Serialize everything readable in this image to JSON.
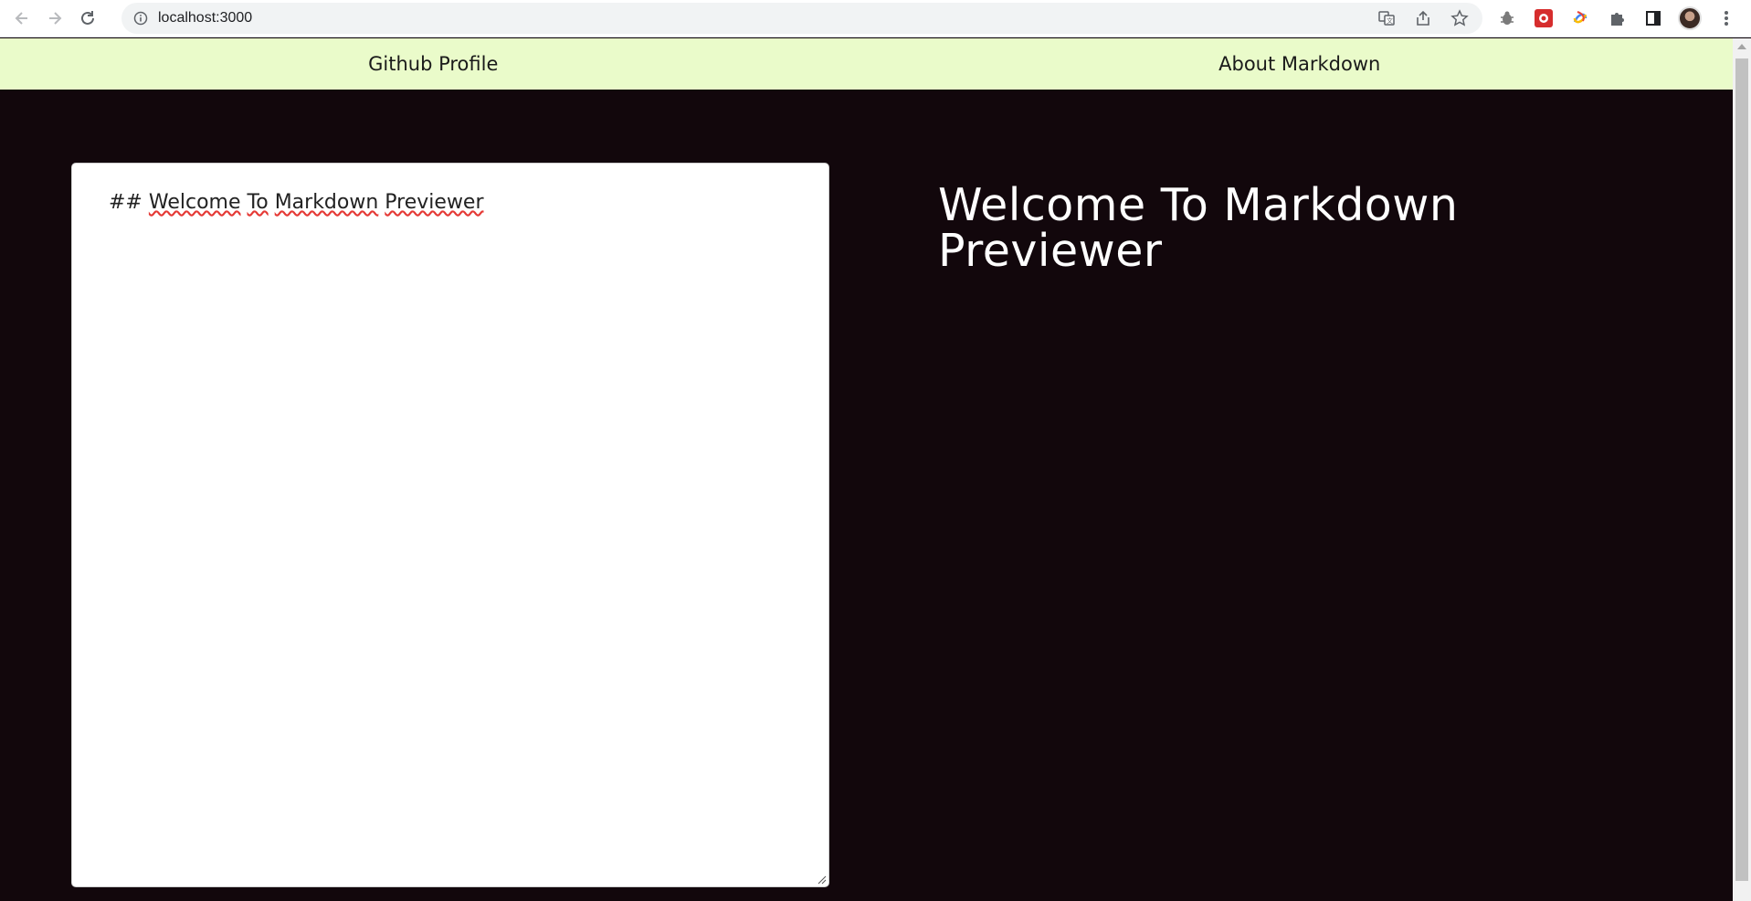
{
  "browser": {
    "url": "localhost:3000",
    "icons": [
      "back-icon",
      "forward-icon",
      "reload-icon",
      "info-icon",
      "translate-icon",
      "share-icon",
      "star-icon",
      "bug-extension-icon",
      "red-extension-icon",
      "swirl-extension-icon",
      "puzzle-extension-icon",
      "side-panel-icon",
      "avatar",
      "kebab-menu-icon"
    ]
  },
  "nav": {
    "github_label": "Github Profile",
    "about_label": "About Markdown"
  },
  "editor": {
    "prefix": "## ",
    "words": [
      "Welcome",
      "To",
      "Markdown",
      "Previewer"
    ]
  },
  "preview": {
    "heading": "Welcome To Markdown Previewer"
  },
  "colors": {
    "nav_bg": "#eafbca",
    "page_bg": "#12070c",
    "editor_bg": "#ffffff",
    "preview_text": "#ffffff"
  }
}
